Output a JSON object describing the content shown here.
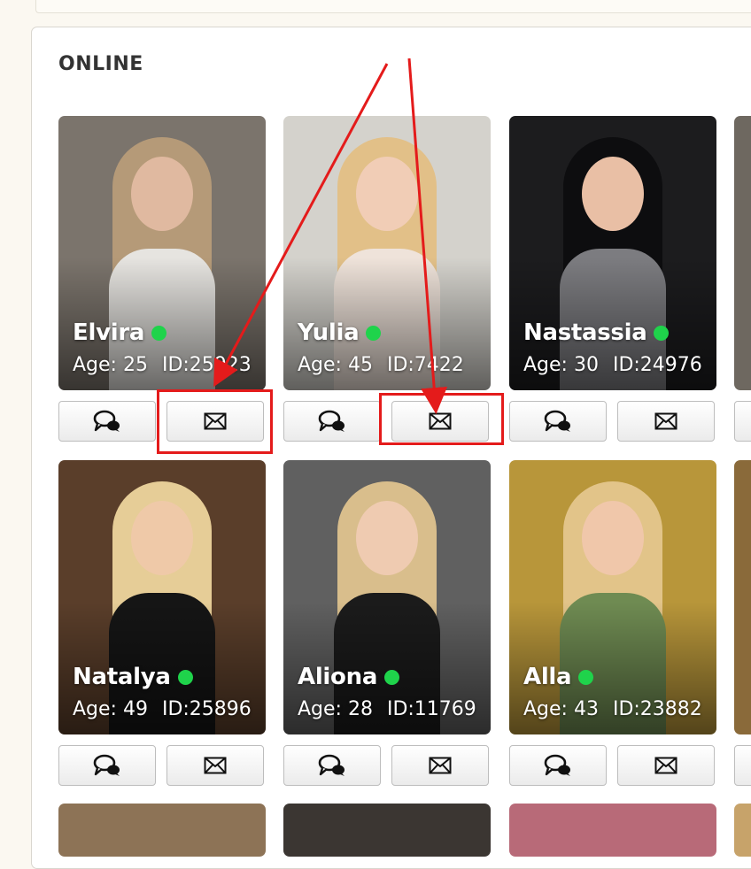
{
  "section": {
    "title": "ONLINE"
  },
  "profiles": [
    {
      "name": "Elvira",
      "age": "Age: 25",
      "id": "ID:25923",
      "bg": "#7b746c",
      "hair": "#b59a78",
      "skin": "#e0b9a0",
      "outfit": "#e6e4e0"
    },
    {
      "name": "Yulia",
      "age": "Age: 45",
      "id": "ID:7422",
      "bg": "#d4d2cc",
      "hair": "#e2c088",
      "skin": "#f1cdb6",
      "outfit": "#efe3da"
    },
    {
      "name": "Nastassia",
      "age": "Age: 30",
      "id": "ID:24976",
      "bg": "#1c1c1e",
      "hair": "#0d0d0f",
      "skin": "#e9bfa5",
      "outfit": "#7c7c80"
    },
    {
      "name": "Natalya",
      "age": "Age: 49",
      "id": "ID:25896",
      "bg": "#5a3e2a",
      "hair": "#e6cd97",
      "skin": "#efc9a8",
      "outfit": "#151515"
    },
    {
      "name": "Aliona",
      "age": "Age: 28",
      "id": "ID:11769",
      "bg": "#606060",
      "hair": "#d9be8c",
      "skin": "#efcbb1",
      "outfit": "#1b1b1b"
    },
    {
      "name": "Alla",
      "age": "Age: 43",
      "id": "ID:23882",
      "bg": "#b8963a",
      "hair": "#e2c489",
      "skin": "#f0c7aa",
      "outfit": "#6f8b52"
    }
  ],
  "icons": {
    "chat": "chat-bubbles-icon",
    "mail": "envelope-icon"
  },
  "colors": {
    "online": "#1fd34b",
    "annotation": "#e41b1b"
  }
}
